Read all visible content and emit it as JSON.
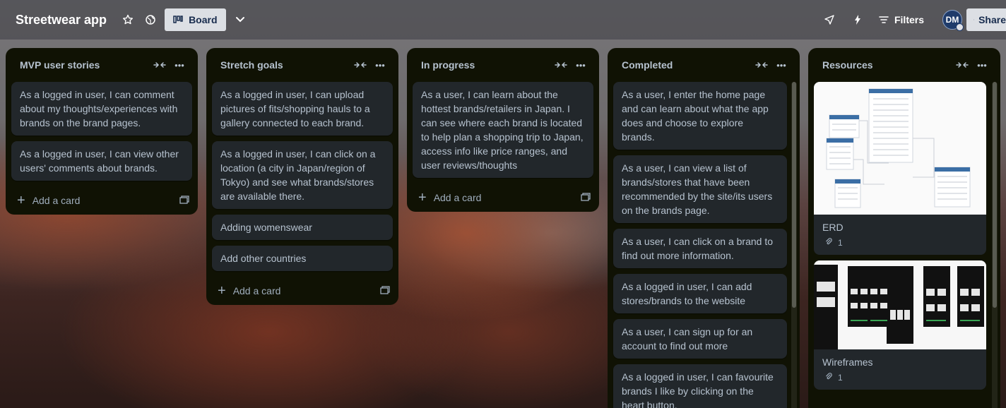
{
  "header": {
    "board_title": "Streetwear app",
    "view_label": "Board",
    "filters_label": "Filters",
    "avatar_initials": "DM",
    "share_label": "Share"
  },
  "lists": [
    {
      "title": "MVP user stories",
      "cards": [
        "As a logged in user, I can comment about my thoughts/experiences with brands on the brand pages.",
        "As a logged in user, I can view other users' comments about brands."
      ],
      "add_label": "Add a card"
    },
    {
      "title": "Stretch goals",
      "cards": [
        "As a logged in user, I can upload pictures of fits/shopping hauls to a gallery connected to each brand.",
        "As a logged in user, I can click on a location (a city in Japan/region of Tokyo) and see what brands/stores are available there.",
        "Adding womenswear",
        "Add other countries"
      ],
      "add_label": "Add a card"
    },
    {
      "title": "In progress",
      "cards": [
        "As a user, I can learn about the hottest brands/retailers in Japan. I can see where each brand is located to help plan a shopping trip to Japan, access info like price ranges, and user reviews/thoughts"
      ],
      "add_label": "Add a card"
    },
    {
      "title": "Completed",
      "cards": [
        "As a user, I enter the home page and can learn about what the app does and choose to explore brands.",
        "As a user, I can view a list of brands/stores that have been recommended by the site/its users on the brands page.",
        "As a user, I can click on a brand to find out more information.",
        "As a logged in user, I can add stores/brands to the website",
        "As a user, I can sign up for an account to find out more",
        "As a logged in user, I can favourite brands I like by clicking on the heart button."
      ]
    },
    {
      "title": "Resources",
      "cards": [
        {
          "title": "ERD",
          "attachments": "1"
        },
        {
          "title": "Wireframes",
          "attachments": "1"
        }
      ]
    }
  ],
  "colors": {
    "list_bg": "#101204",
    "card_bg": "#22272b",
    "text": "#b6c2cf",
    "header_button_bg": "#dcdfe4"
  }
}
